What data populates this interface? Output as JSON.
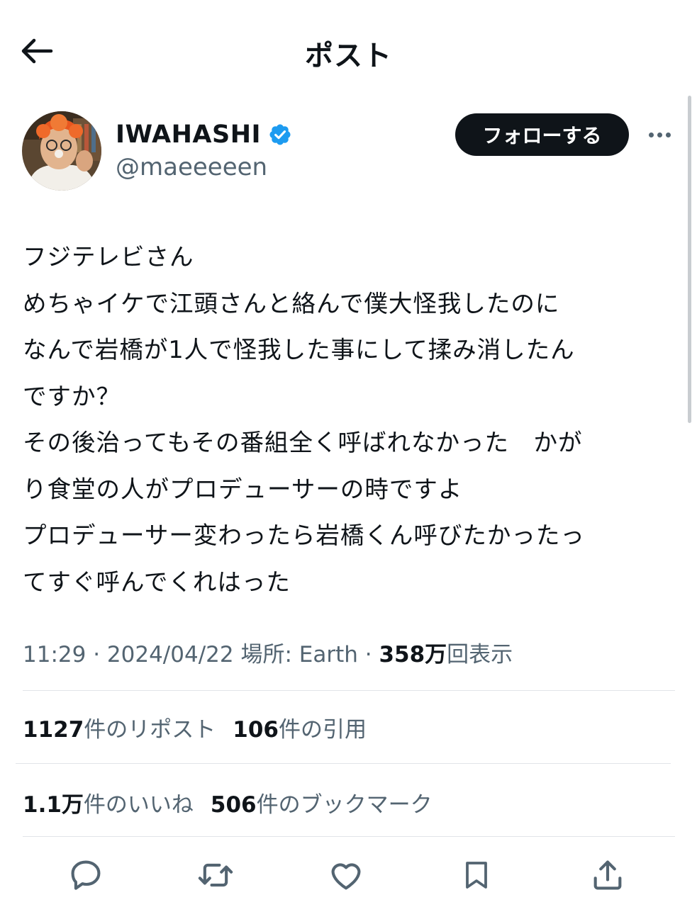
{
  "header": {
    "title": "ポスト"
  },
  "author": {
    "display_name": "IWAHASHI",
    "handle": "@maeeeeen",
    "verified": true
  },
  "follow_button_label": "フォローする",
  "tweet_lines": [
    "フジテレビさん",
    "めちゃイケで江頭さんと絡んで僕大怪我したのに",
    "なんで岩橋が1人で怪我した事にして揉み消したん",
    "ですか？",
    "その後治ってもその番組全く呼ばれなかった　かが",
    "り食堂の人がプロデューサーの時ですよ",
    "プロデューサー変わったら岩橋くん呼びたかったっ",
    "てすぐ呼んでくれはった"
  ],
  "meta": {
    "time": "11:29",
    "date": "2024/04/22",
    "location": "場所: Earth",
    "views_count": "358万",
    "views_label": "回表示"
  },
  "stats": {
    "reposts_count": "1127",
    "reposts_label": "件のリポスト",
    "quotes_count": "106",
    "quotes_label": "件の引用",
    "likes_count": "1.1万",
    "likes_label": "件のいいね",
    "bookmarks_count": "506",
    "bookmarks_label": "件のブックマーク"
  },
  "colors": {
    "text": "#0f1419",
    "secondary": "#536471",
    "verified": "#1d9bf0",
    "divider": "#e1e4e8"
  },
  "icons": [
    "back-arrow-icon",
    "verified-badge-icon",
    "more-icon",
    "reply-icon",
    "repost-icon",
    "like-icon",
    "bookmark-icon",
    "share-icon"
  ]
}
